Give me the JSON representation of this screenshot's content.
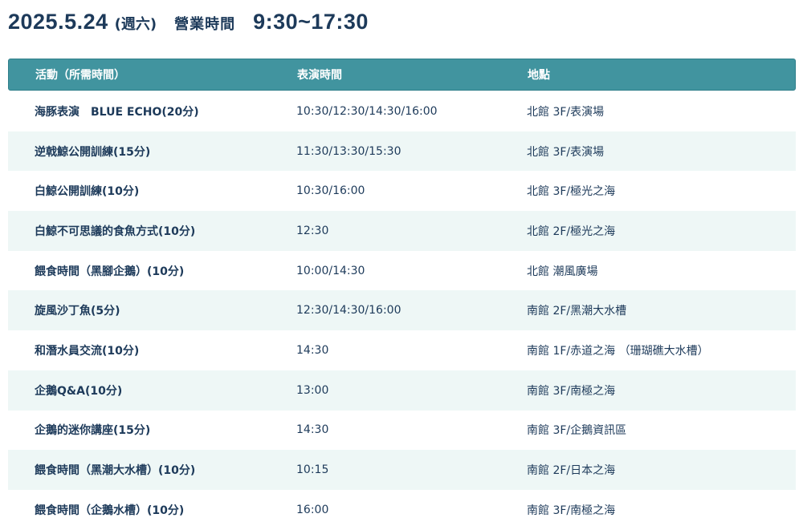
{
  "header": {
    "date": "2025.5.24",
    "weekday": "(週六)",
    "hours_label": "營業時間",
    "hours": "9:30~17:30"
  },
  "table": {
    "columns": {
      "activity": "活動（所需時間）",
      "time": "表演時間",
      "location": "地點"
    },
    "rows": [
      {
        "activity": "海豚表演　BLUE ECHO(20分)",
        "time": "10:30/12:30/14:30/16:00",
        "location": "北館 3F/表演場"
      },
      {
        "activity": "逆戟鯨公開訓練(15分)",
        "time": "11:30/13:30/15:30",
        "location": "北館 3F/表演場"
      },
      {
        "activity": "白鯨公開訓練(10分)",
        "time": "10:30/16:00",
        "location": "北館 3F/極光之海"
      },
      {
        "activity": "白鯨不可思議的食魚方式(10分)",
        "time": "12:30",
        "location": "北館 2F/極光之海"
      },
      {
        "activity": "餵食時間（黑腳企鵝）(10分)",
        "time": "10:00/14:30",
        "location": "北館 潮風廣場"
      },
      {
        "activity": "旋風沙丁魚(5分)",
        "time": "12:30/14:30/16:00",
        "location": "南館 2F/黑潮大水槽"
      },
      {
        "activity": "和潛水員交流(10分)",
        "time": "14:30",
        "location": "南館 1F/赤道之海 （珊瑚礁大水槽）"
      },
      {
        "activity": "企鵝Q&A(10分)",
        "time": "13:00",
        "location": "南館 3F/南極之海"
      },
      {
        "activity": "企鵝的迷你講座(15分)",
        "time": "14:30",
        "location": "南館 3F/企鵝資訊區"
      },
      {
        "activity": "餵食時間（黑潮大水槽）(10分)",
        "time": "10:15",
        "location": "南館 2F/日本之海"
      },
      {
        "activity": "餵食時間（企鵝水槽）(10分)",
        "time": "16:00",
        "location": "南館 3F/南極之海"
      }
    ]
  }
}
